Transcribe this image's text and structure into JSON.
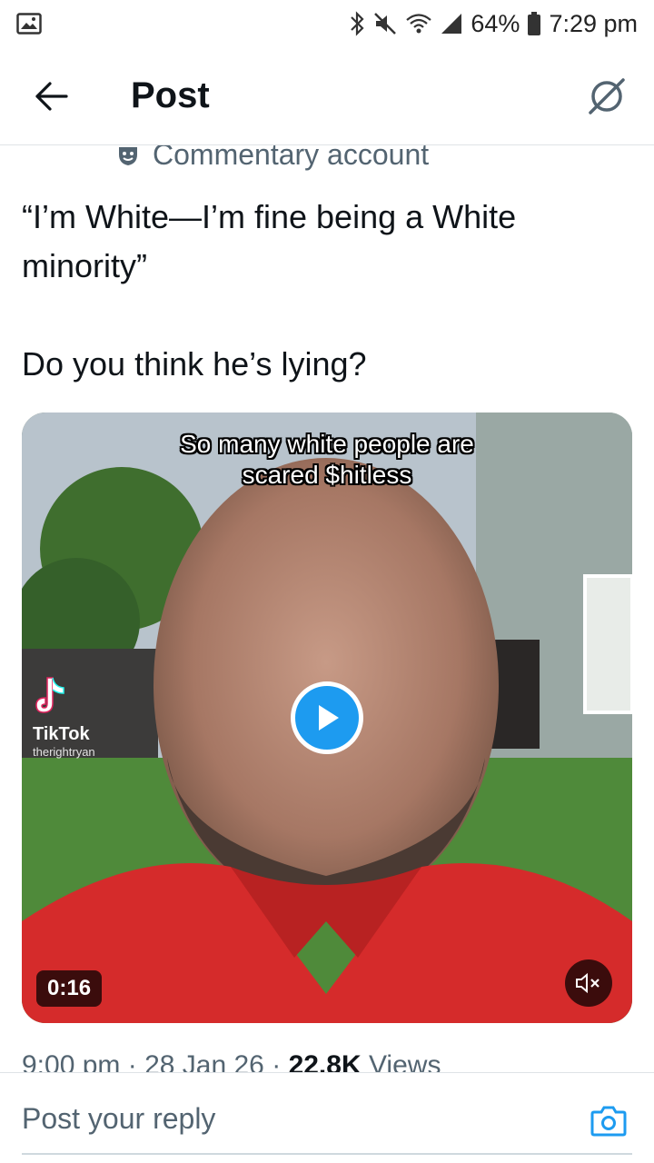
{
  "status_bar": {
    "battery_percent": "64%",
    "time": "7:29 pm",
    "icons": [
      "gallery-icon",
      "bluetooth-icon",
      "mute-icon",
      "wifi-icon",
      "signal-icon",
      "battery-icon"
    ]
  },
  "header": {
    "title": "Post",
    "back_icon": "arrow-left-icon",
    "grok_icon": "grok-icon"
  },
  "post": {
    "label": "Commentary account",
    "text_line1": "“I’m White—I’m fine being a White minority”",
    "text_line2": "Do you think he’s lying?",
    "media": {
      "caption_line1": "So many white people are",
      "caption_line2": "scared $hitless",
      "watermark_brand": "TikTok",
      "watermark_handle": "therightryan",
      "duration": "0:16",
      "muted": true
    },
    "meta": {
      "time": "9:00 pm",
      "separator": "·",
      "date": "28 Jan 26",
      "views_count": "22.8K",
      "views_label": "Views"
    }
  },
  "reply": {
    "placeholder": "Post your reply"
  },
  "colors": {
    "accent": "#1d9bf0",
    "text_primary": "#0f1419",
    "text_secondary": "#536471"
  }
}
